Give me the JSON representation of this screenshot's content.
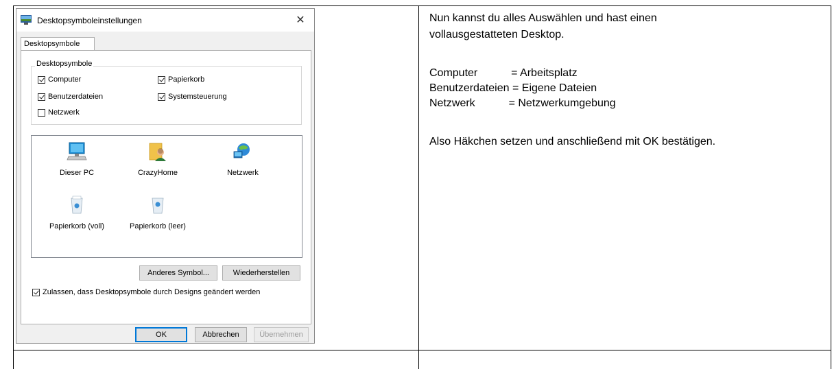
{
  "dialog": {
    "title": "Desktopsymboleinstellungen",
    "close_label": "✕",
    "tab_label": "Desktopsymbole",
    "group_label": "Desktopsymbole",
    "checkboxes": [
      {
        "label": "Computer",
        "checked": true
      },
      {
        "label": "Papierkorb",
        "checked": true
      },
      {
        "label": "Benutzerdateien",
        "checked": true
      },
      {
        "label": "Systemsteuerung",
        "checked": true
      },
      {
        "label": "Netzwerk",
        "checked": false
      }
    ],
    "icons": [
      {
        "label": "Dieser PC",
        "icon": "computer-icon"
      },
      {
        "label": "CrazyHome",
        "icon": "user-folder-icon"
      },
      {
        "label": "Netzwerk",
        "icon": "network-icon"
      },
      {
        "label": "Papierkorb (voll)",
        "icon": "recycle-bin-full-icon"
      },
      {
        "label": "Papierkorb (leer)",
        "icon": "recycle-bin-empty-icon"
      }
    ],
    "change_icon_label": "Anderes Symbol...",
    "restore_label": "Wiederherstellen",
    "allow_themes_label": "Zulassen, dass Desktopsymbole durch Designs geändert werden",
    "allow_themes_checked": true,
    "ok_label": "OK",
    "cancel_label": "Abbrechen",
    "apply_label": "Übernehmen"
  },
  "doc": {
    "line1": "Nun kannst du alles Auswählen und hast einen",
    "line2": "vollausgestatteten Desktop.",
    "line3": "Computer           = Arbeitsplatz",
    "line4": "Benutzerdateien = Eigene Dateien",
    "line5": "Netzwerk           = Netzwerkumgebung",
    "line6": "Also Häkchen setzen und anschließend mit OK bestätigen."
  }
}
